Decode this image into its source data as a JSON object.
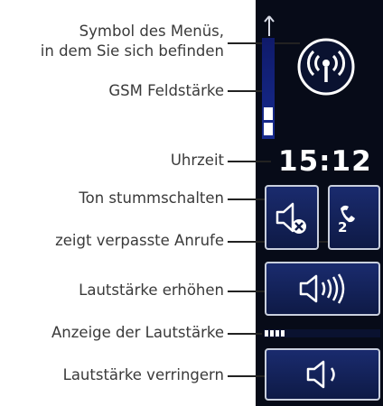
{
  "labels": {
    "menu_symbol_line1": "Symbol des Menüs,",
    "menu_symbol_line2": "in dem Sie sich befinden",
    "gsm_signal": "GSM Feldstärke",
    "time": "Uhrzeit",
    "mute": "Ton stummschalten",
    "missed_calls": "zeigt verpasste Anrufe",
    "volume_up": "Lautstärke erhöhen",
    "volume_display": "Anzeige der Lautstärke",
    "volume_down": "Lautstärke verringern"
  },
  "display": {
    "clock": "15:12",
    "missed_calls_count": "2",
    "signal_level": 0.3,
    "volume_level": 0.3
  },
  "icons": {
    "menu": "broadcast-antenna-icon",
    "signal_top": "antenna-icon",
    "mute": "speaker-muted-icon",
    "missed": "phone-handset-icon",
    "volume_up": "speaker-loud-icon",
    "volume_down": "speaker-quiet-icon"
  },
  "colors": {
    "panel_bg": "#070b18",
    "button_fill": "#142466",
    "button_border": "#c9cfdd",
    "text_label": "#3a3a3a",
    "display_text": "#ffffff"
  }
}
